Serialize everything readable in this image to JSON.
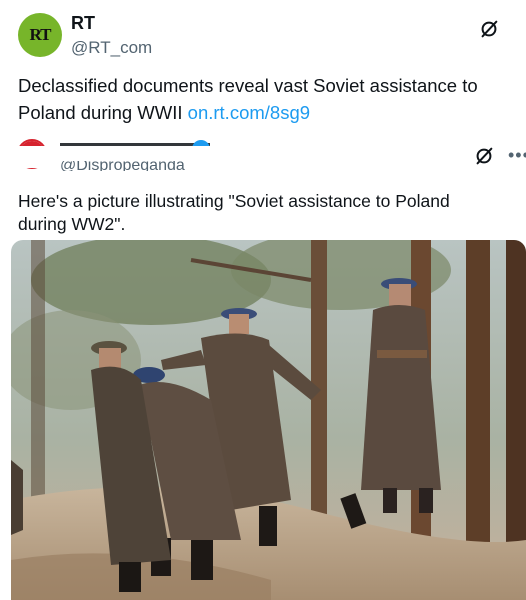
{
  "tweet": {
    "author_name": "RT",
    "author_handle": "@RT_com",
    "avatar_text": "RT",
    "text": "Declassified documents reveal vast Soviet assistance to Poland during WWII ",
    "link": "on.rt.com/8sg9"
  },
  "quoted": {
    "handle": "@Dispropеganda",
    "text": "Here's a picture illustrating \"Soviet assistance to Poland during WW2\".",
    "more_label": "•••"
  },
  "colors": {
    "rt_green": "#77b52a",
    "link_blue": "#1d9bf0",
    "secondary_text": "#536471",
    "primary_text": "#0f1419"
  },
  "icons": {
    "top_action": "x-logo-icon",
    "quoted_action": "x-logo-icon",
    "verified": "verified-badge-icon"
  }
}
